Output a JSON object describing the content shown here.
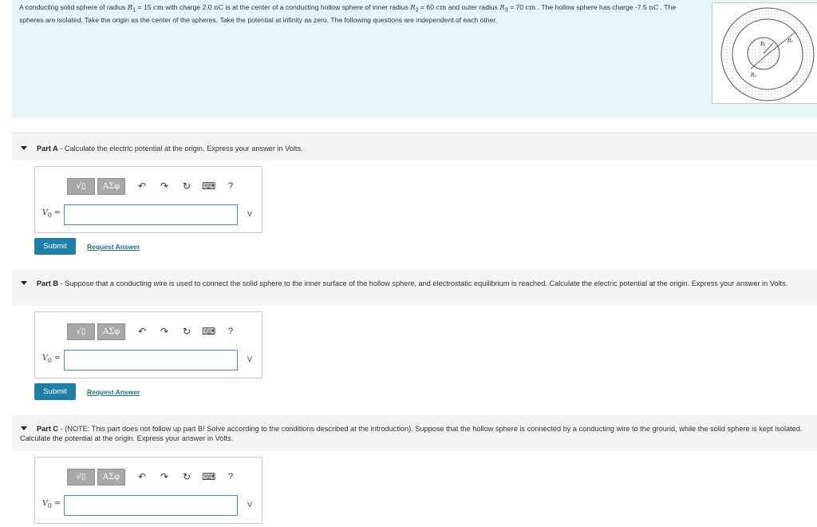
{
  "intro": {
    "p1": "A conducting solid sphere of radius ",
    "r1_sym": "R",
    "r1_sub": "1",
    "p2": " = 15 ",
    "unit_cm_1": "cm",
    "p3": " with charge 2.0 ",
    "unit_nc_1": "nC",
    "p4": " is at the center of a conducting hollow sphere of inner radius ",
    "r2_sym": "R",
    "r2_sub": "2",
    "p5": " = 60 ",
    "unit_cm_2": "cm",
    "p6": " and outer radius ",
    "r3_sym": "R",
    "r3_sub": "3",
    "p7": " = 70 ",
    "unit_cm_3": "cm",
    "p8": " . The hollow sphere has charge -7.5 ",
    "unit_nc_2": "nC",
    "p9": " . The spheres are isolated. Take the origin as the center of the spheres. Take the potential at infinity as zero. The following questions are independent of each other."
  },
  "figure": {
    "label_r1": "R₁",
    "label_r2": "R₂",
    "label_r3": "R₃"
  },
  "parts": [
    {
      "label": "Part A",
      "text": " - Calculate the electric potential at the origin. Express your answer in Volts."
    },
    {
      "label": "Part B",
      "text": " - Suppose that a conducting wire is used to connect the solid sphere to the inner surface of the hollow sphere, and electrostatic equilibrium is reached. Calculate the electric potential at the origin. Express your answer in Volts."
    },
    {
      "label": "Part C",
      "text": " - (NOTE: This part does not follow up part B! Solve according to the conditions described at the introduction). Suppose that the hollow sphere is connected by a conducting wire to the ground, while the solid sphere is kept isolated. Calculate the potential at the origin. Express your answer in Volts."
    }
  ],
  "toolbar": {
    "templates_label": "√▯",
    "greek_label": "ΑΣφ",
    "undo_icon": "↶",
    "redo_icon": "↷",
    "reset_icon": "↻",
    "keyboard_icon": "⌨",
    "help_label": "?"
  },
  "answer": {
    "var_symbol": "V",
    "var_sub": "0",
    "equals": " =",
    "value": "",
    "unit": "V"
  },
  "buttons": {
    "submit_label": "Submit",
    "request_label": "Request Answer"
  },
  "colors": {
    "intro_bg": "#e6f5f5",
    "submit_bg": "#1e7fa8",
    "link": "#1c6da3",
    "input_border": "#4a86c5"
  }
}
